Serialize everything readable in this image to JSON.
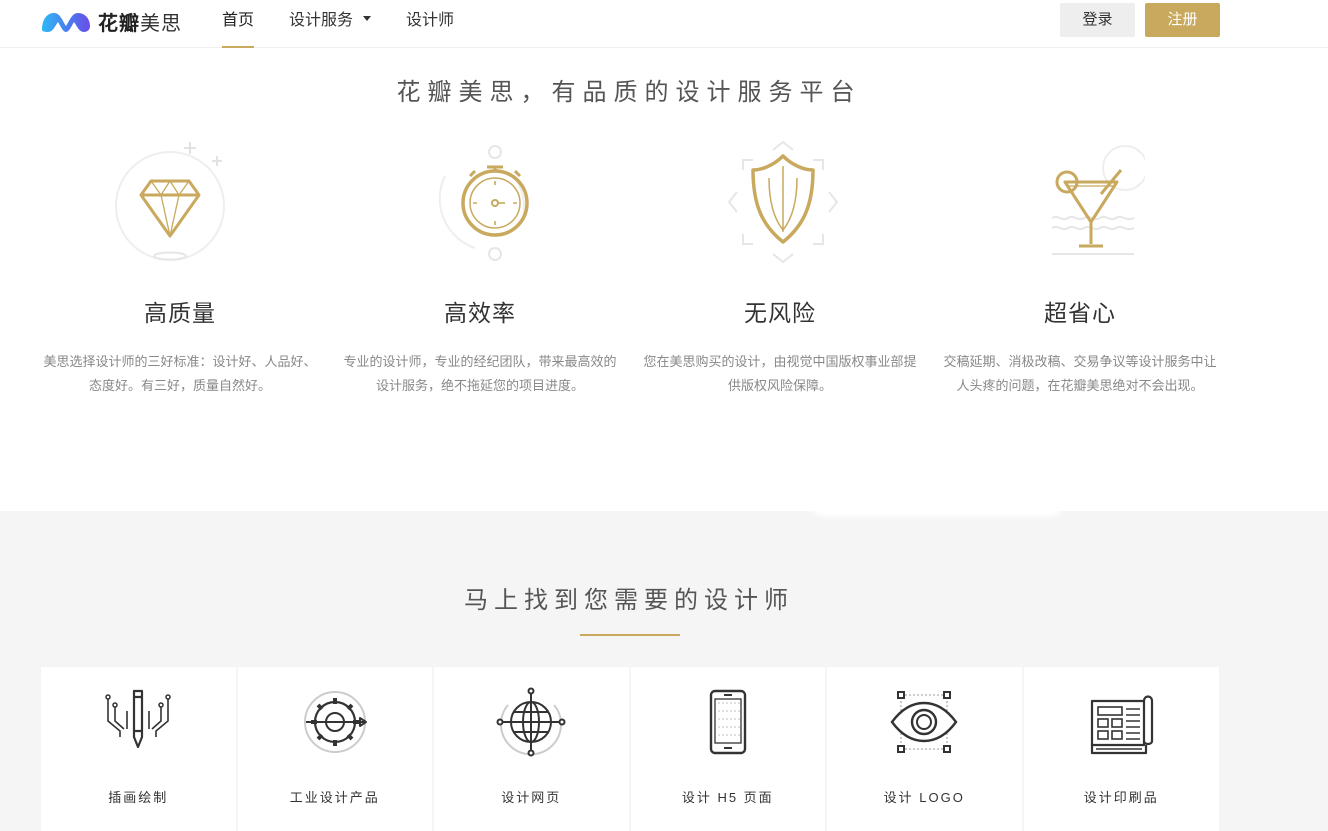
{
  "header": {
    "logo_bold": "花瓣",
    "logo_light": "美思",
    "nav": [
      {
        "label": "首页",
        "active": true
      },
      {
        "label": "设计服务",
        "dropdown": true
      },
      {
        "label": "设计师"
      }
    ],
    "login_label": "登录",
    "register_label": "注册"
  },
  "colors": {
    "accent": "#c8a95d",
    "icon_gray": "#e6e6e6",
    "text_gray": "#888888"
  },
  "features": {
    "slogan": "花瓣美思，有品质的设计服务平台",
    "items": [
      {
        "icon": "diamond-icon",
        "title": "高质量",
        "desc": "美思选择设计师的三好标准：设计好、人品好、态度好。有三好，质量自然好。"
      },
      {
        "icon": "stopwatch-icon",
        "title": "高效率",
        "desc": "专业的设计师，专业的经纪团队，带来最高效的设计服务，绝不拖延您的项目进度。"
      },
      {
        "icon": "shield-icon",
        "title": "无风险",
        "desc": "您在美思购买的设计，由视觉中国版权事业部提供版权风险保障。"
      },
      {
        "icon": "cocktail-icon",
        "title": "超省心",
        "desc": "交稿延期、消极改稿、交易争议等设计服务中让人头疼的问题，在花瓣美思绝对不会出现。"
      }
    ]
  },
  "designers": {
    "title": "马上找到您需要的设计师",
    "categories": [
      {
        "icon": "pencil-circuit-icon",
        "label": "插画绘制"
      },
      {
        "icon": "gear-pen-icon",
        "label": "工业设计产品"
      },
      {
        "icon": "globe-icon",
        "label": "设计网页"
      },
      {
        "icon": "mobile-phone-icon",
        "label": "设计 H5 页面"
      },
      {
        "icon": "eye-icon",
        "label": "设计 LOGO"
      },
      {
        "icon": "printed-matter-icon",
        "label": "设计印刷品"
      }
    ]
  }
}
